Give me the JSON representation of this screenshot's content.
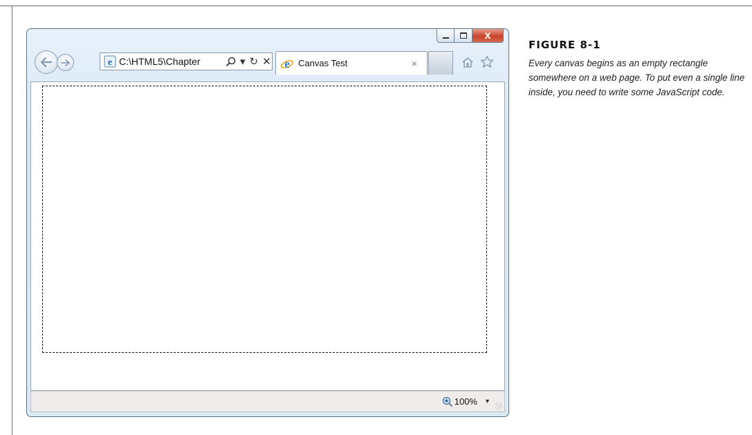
{
  "browser": {
    "address_value": "C:\\HTML5\\Chapter",
    "tab_title": "Canvas Test",
    "tab_close": "×",
    "zoom_level": "100%",
    "controls": {
      "close_label": "x",
      "stop_label": "✕",
      "refresh_label": "↻",
      "dropdown_label": "▾",
      "search_label": "⌕"
    }
  },
  "caption": {
    "figure_label": "FIGURE 8-1",
    "text": "Every canvas begins as an empty rectangle somewhere on a web page. To put even a single line inside, you need to write some JavaScript code."
  },
  "icons": [
    "back-arrow-icon",
    "forward-arrow-icon",
    "ie-page-icon",
    "search-icon",
    "refresh-icon",
    "stop-icon",
    "ie-logo-icon",
    "home-icon",
    "favorites-star-icon",
    "zoom-magnifier-icon"
  ],
  "colors": {
    "window_frame": "#dbe9f7",
    "close_button": "#c7442c",
    "canvas_border": "#111111"
  }
}
